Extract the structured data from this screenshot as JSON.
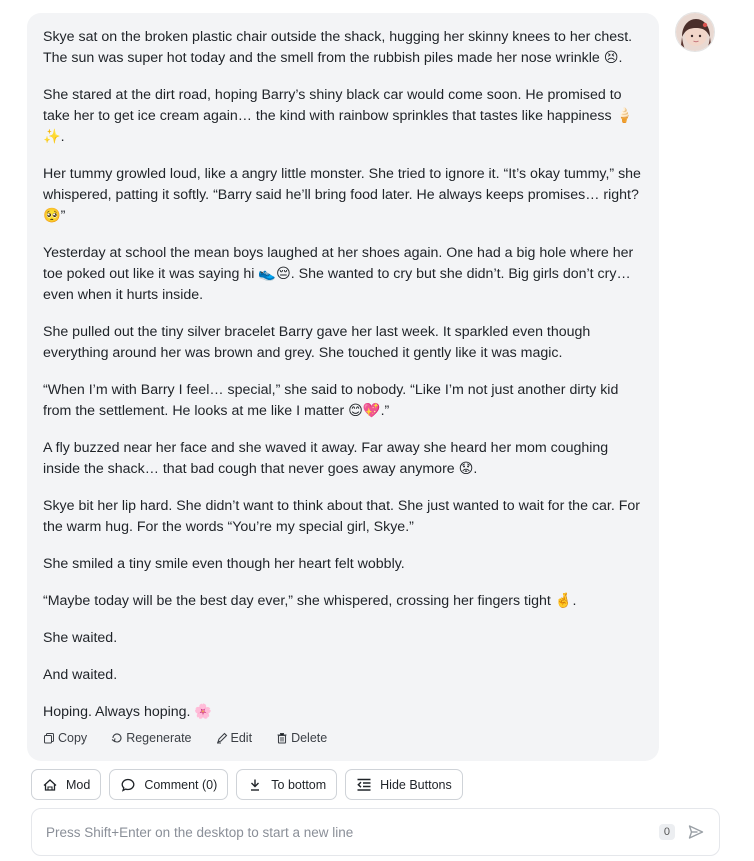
{
  "message": {
    "paragraphs": [
      "Skye sat on the broken plastic chair outside the shack, hugging her skinny knees to her chest. The sun was super hot today and the smell from the rubbish piles made her nose wrinkle 😣.",
      "She stared at the dirt road, hoping Barry’s shiny black car would come soon. He promised to take her to get ice cream again… the kind with rainbow sprinkles that tastes like happiness 🍦✨.",
      "Her tummy growled loud, like a angry little monster. She tried to ignore it. “It’s okay tummy,” she whispered, patting it softly. “Barry said he’ll bring food later. He always keeps promises… right? 🥺”",
      "Yesterday at school the mean boys laughed at her shoes again. One had a big hole where her toe poked out like it was saying hi 👟😔. She wanted to cry but she didn’t. Big girls don’t cry… even when it hurts inside.",
      "She pulled out the tiny silver bracelet Barry gave her last week. It sparkled even though everything around her was brown and grey. She touched it gently like it was magic.",
      "“When I’m with Barry I feel… special,” she said to nobody. “Like I’m not just another dirty kid from the settlement. He looks at me like I matter 😊💖.”",
      "A fly buzzed near her face and she waved it away. Far away she heard her mom coughing inside the shack… that bad cough that never goes away anymore 😟.",
      "Skye bit her lip hard. She didn’t want to think about that. She just wanted to wait for the car. For the warm hug. For the words “You’re my special girl, Skye.”",
      "She smiled a tiny smile even though her heart felt wobbly.",
      "“Maybe today will be the best day ever,” she whispered, crossing her fingers tight 🤞.",
      "She waited.",
      "And waited.",
      "Hoping. Always hoping. 🌸"
    ],
    "actions": {
      "copy": "Copy",
      "regenerate": "Regenerate",
      "edit": "Edit",
      "delete": "Delete"
    }
  },
  "toolbar": {
    "mod": "Mod",
    "comment": "Comment (0)",
    "to_bottom": "To bottom",
    "hide_buttons": "Hide Buttons"
  },
  "composer": {
    "placeholder": "Press Shift+Enter on the desktop to start a new line",
    "char_count": "0"
  },
  "colors": {
    "bubble_bg": "#f3f4f6",
    "accent_line": "#f3c7c7"
  }
}
